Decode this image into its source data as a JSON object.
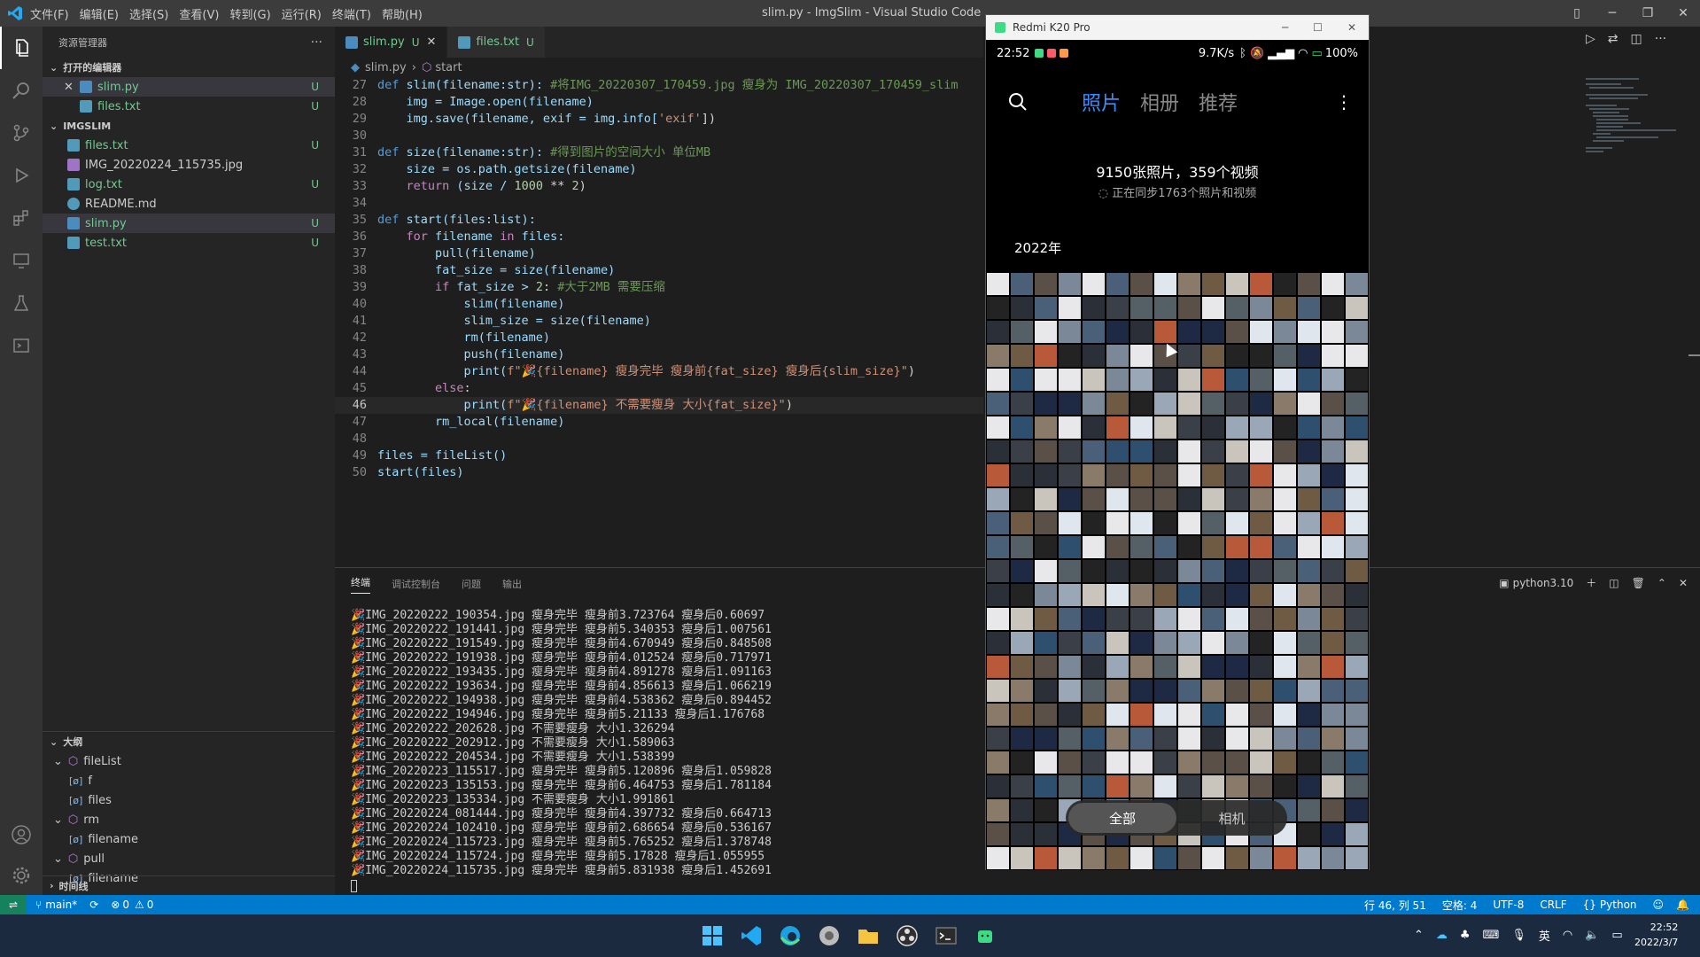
{
  "window": {
    "title": "slim.py - ImgSlim - Visual Studio Code"
  },
  "menu": [
    "文件(F)",
    "编辑(E)",
    "选择(S)",
    "查看(V)",
    "转到(G)",
    "运行(R)",
    "终端(T)",
    "帮助(H)"
  ],
  "sidebar": {
    "header": "资源管理器",
    "open_editors_title": "打开的编辑器",
    "open_editors": [
      {
        "name": "slim.py",
        "badge": "U"
      },
      {
        "name": "files.txt",
        "badge": "U"
      }
    ],
    "project_title": "IMGSLIM",
    "files": [
      {
        "name": "files.txt",
        "badge": "U",
        "icon": "text-file-icon"
      },
      {
        "name": "IMG_20220224_115735.jpg",
        "badge": "",
        "icon": "image-file-icon"
      },
      {
        "name": "log.txt",
        "badge": "U",
        "icon": "text-file-icon"
      },
      {
        "name": "README.md",
        "badge": "",
        "icon": "info-icon"
      },
      {
        "name": "slim.py",
        "badge": "U",
        "icon": "python-icon"
      },
      {
        "name": "test.txt",
        "badge": "U",
        "icon": "text-file-icon"
      }
    ],
    "outline_title": "大纲",
    "outline": [
      {
        "name": "fileList",
        "level": 1
      },
      {
        "name": "f",
        "level": 2
      },
      {
        "name": "files",
        "level": 2
      },
      {
        "name": "rm",
        "level": 1
      },
      {
        "name": "filename",
        "level": 2
      },
      {
        "name": "pull",
        "level": 1
      },
      {
        "name": "filename",
        "level": 2
      }
    ],
    "timeline_title": "时间线"
  },
  "tabs": [
    {
      "name": "slim.py",
      "badge": "U",
      "active": true
    },
    {
      "name": "files.txt",
      "badge": "U",
      "active": false
    }
  ],
  "breadcrumb": [
    "slim.py",
    "start"
  ],
  "code": [
    {
      "n": "27",
      "t": "def slim(filename:str): #将IMG_20220307_170459.jpg 瘦身为 IMG_20220307_170459_slim"
    },
    {
      "n": "28",
      "t": "    img = Image.open(filename)"
    },
    {
      "n": "29",
      "t": "    img.save(filename, exif = img.info['exif'])"
    },
    {
      "n": "30",
      "t": ""
    },
    {
      "n": "31",
      "t": "def size(filename:str): #得到图片的空间大小 单位MB"
    },
    {
      "n": "32",
      "t": "    size = os.path.getsize(filename)"
    },
    {
      "n": "33",
      "t": "    return (size / 1000 ** 2)"
    },
    {
      "n": "34",
      "t": ""
    },
    {
      "n": "35",
      "t": "def start(files:list):"
    },
    {
      "n": "36",
      "t": "    for filename in files:"
    },
    {
      "n": "37",
      "t": "        pull(filename)"
    },
    {
      "n": "38",
      "t": "        fat_size = size(filename)"
    },
    {
      "n": "39",
      "t": "        if fat_size > 2: #大于2MB 需要压缩"
    },
    {
      "n": "40",
      "t": "            slim(filename)"
    },
    {
      "n": "41",
      "t": "            slim_size = size(filename)"
    },
    {
      "n": "42",
      "t": "            rm(filename)"
    },
    {
      "n": "43",
      "t": "            push(filename)"
    },
    {
      "n": "44",
      "t": "            print(f\"🎉{filename} 瘦身完毕 瘦身前{fat_size} 瘦身后{slim_size}\")"
    },
    {
      "n": "45",
      "t": "        else:"
    },
    {
      "n": "46",
      "t": "            print(f\"🎉{filename} 不需要瘦身 大小{fat_size}\")"
    },
    {
      "n": "47",
      "t": "        rm_local(filename)"
    },
    {
      "n": "48",
      "t": ""
    },
    {
      "n": "49",
      "t": "files = fileList()"
    },
    {
      "n": "50",
      "t": "start(files)"
    }
  ],
  "panel": {
    "tabs": [
      "终端",
      "调试控制台",
      "问题",
      "输出"
    ],
    "terminal_name": "python3.10",
    "lines": [
      "🎉IMG_20220222_190354.jpg 瘦身完毕 瘦身前3.723764 瘦身后0.60697",
      "🎉IMG_20220222_191441.jpg 瘦身完毕 瘦身前5.340353 瘦身后1.007561",
      "🎉IMG_20220222_191549.jpg 瘦身完毕 瘦身前4.670949 瘦身后0.848508",
      "🎉IMG_20220222_191938.jpg 瘦身完毕 瘦身前4.012524 瘦身后0.717971",
      "🎉IMG_20220222_193435.jpg 瘦身完毕 瘦身前4.891278 瘦身后1.091163",
      "🎉IMG_20220222_193634.jpg 瘦身完毕 瘦身前4.856613 瘦身后1.066219",
      "🎉IMG_20220222_194938.jpg 瘦身完毕 瘦身前4.538362 瘦身后0.894452",
      "🎉IMG_20220222_194946.jpg 瘦身完毕 瘦身前5.21133 瘦身后1.176768",
      "🎉IMG_20220222_202628.jpg 不需要瘦身 大小1.326294",
      "🎉IMG_20220222_202912.jpg 不需要瘦身 大小1.589063",
      "🎉IMG_20220222_204534.jpg 不需要瘦身 大小1.538399",
      "🎉IMG_20220223_115517.jpg 瘦身完毕 瘦身前5.120896 瘦身后1.059828",
      "🎉IMG_20220223_135153.jpg 瘦身完毕 瘦身前6.464753 瘦身后1.781184",
      "🎉IMG_20220223_135334.jpg 不需要瘦身 大小1.991861",
      "🎉IMG_20220224_081444.jpg 瘦身完毕 瘦身前4.397732 瘦身后0.664713",
      "🎉IMG_20220224_102410.jpg 瘦身完毕 瘦身前2.686654 瘦身后0.536167",
      "🎉IMG_20220224_115723.jpg 瘦身完毕 瘦身前5.765252 瘦身后1.378748",
      "🎉IMG_20220224_115724.jpg 瘦身完毕 瘦身前5.17828 瘦身后1.055955",
      "🎉IMG_20220224_115735.jpg 瘦身完毕 瘦身前5.831938 瘦身后1.452691"
    ]
  },
  "status": {
    "branch": "main*",
    "errors": "0",
    "warnings": "0",
    "position": "行 46, 列 51",
    "spaces": "空格: 4",
    "encoding": "UTF-8",
    "eol": "CRLF",
    "language": "Python"
  },
  "phone": {
    "title": "Redmi K20 Pro",
    "time": "22:52",
    "net_speed": "9.7K/s",
    "battery": "100",
    "tabs": [
      "照片",
      "相册",
      "推荐"
    ],
    "count": "9150张照片，359个视频",
    "sync": "正在同步1763个照片和视频",
    "year": "2022年",
    "filter": [
      "全部",
      "相机"
    ]
  },
  "taskbar": {
    "time": "22:52",
    "date": "2022/3/7",
    "ime": "英"
  },
  "colors": {
    "accent": "#007acc",
    "phone_accent": "#3a8dff",
    "untracked": "#73c991"
  }
}
